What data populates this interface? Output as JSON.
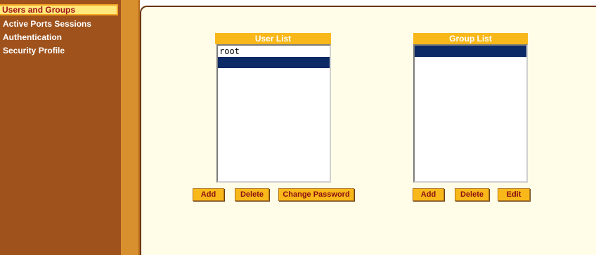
{
  "sidebar": {
    "items": [
      {
        "label": "Users and Groups",
        "active": true
      },
      {
        "label": "Active Ports Sessions",
        "active": false
      },
      {
        "label": "Authentication",
        "active": false
      },
      {
        "label": "Security Profile",
        "active": false
      }
    ]
  },
  "user_list": {
    "title": "User List",
    "items": [
      "root",
      ""
    ],
    "selected_index": 1,
    "buttons": {
      "add": "Add",
      "delete": "Delete",
      "change_password": "Change Password"
    }
  },
  "group_list": {
    "title": "Group List",
    "items": [
      ""
    ],
    "selected_index": 0,
    "buttons": {
      "add": "Add",
      "delete": "Delete",
      "edit": "Edit"
    }
  },
  "colors": {
    "sidebar_bg": "#9f521c",
    "stripe": "#d8902f",
    "content_bg": "#fffce8",
    "accent": "#f8b81a",
    "selection": "#0c2a66",
    "button_text": "#8a0f12"
  }
}
